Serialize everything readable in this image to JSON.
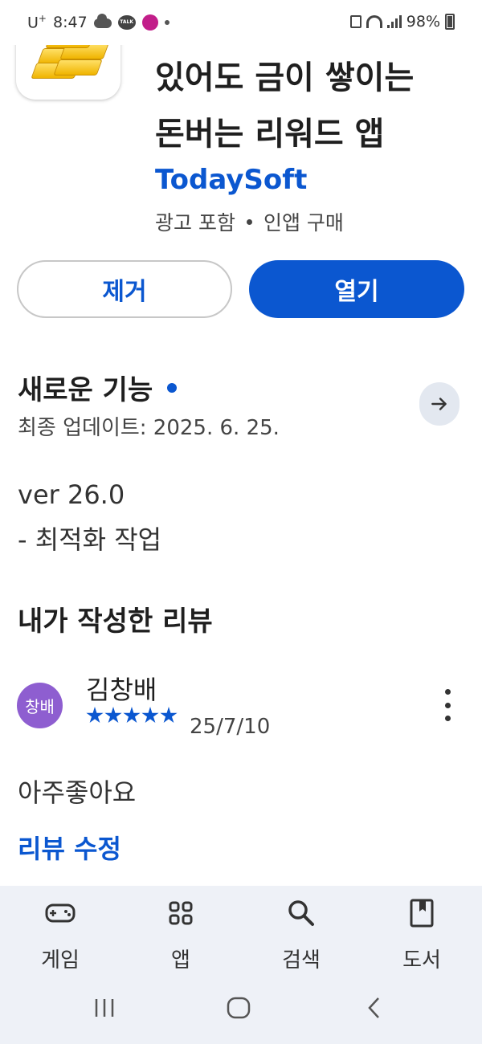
{
  "status_bar": {
    "carrier": "U",
    "carrier_sup": "+",
    "time": "8:47",
    "talk_badge": "TALK",
    "battery": "98%"
  },
  "app": {
    "title_lines": [
      "있어도 금이 쌓이는",
      "돈버는 리워드 앱"
    ],
    "developer": "TodaySoft",
    "meta_ads": "광고 포함",
    "meta_iap": "인앱 구매"
  },
  "actions": {
    "remove_label": "제거",
    "open_label": "열기"
  },
  "whats_new": {
    "title": "새로운 기능",
    "last_updated": "최종 업데이트: 2025. 6. 25.",
    "version": "ver 26.0",
    "note": "- 최적화 작업"
  },
  "my_review": {
    "section_title": "내가 작성한 리뷰",
    "avatar_text": "창배",
    "reviewer_name": "김창배",
    "rating": 5,
    "date": "25/7/10",
    "text": "아주좋아요",
    "edit_label": "리뷰 수정"
  },
  "bottom_nav": {
    "items": [
      {
        "label": "게임",
        "icon": "gamepad-icon"
      },
      {
        "label": "앱",
        "icon": "apps-grid-icon"
      },
      {
        "label": "검색",
        "icon": "search-icon"
      },
      {
        "label": "도서",
        "icon": "book-icon"
      }
    ]
  },
  "colors": {
    "accent": "#0b57d0",
    "avatar": "#8e5ed0",
    "nav_bg": "#eef1f7"
  }
}
